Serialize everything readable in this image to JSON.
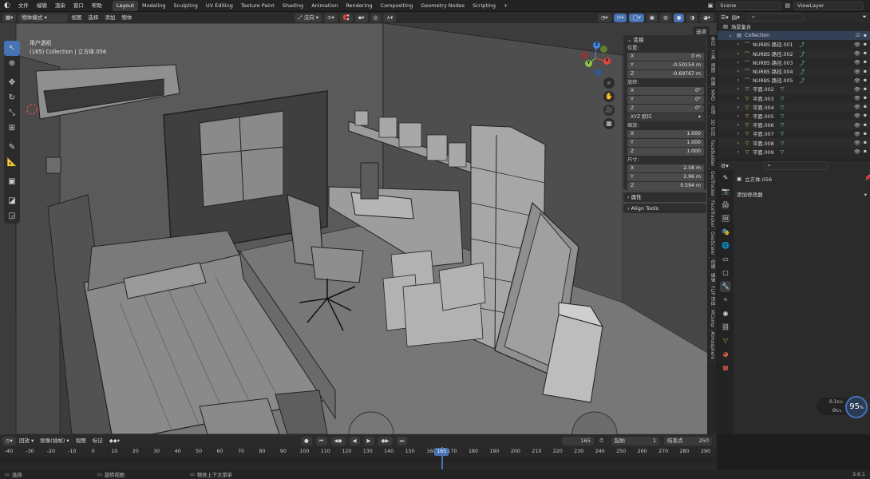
{
  "topbar": {
    "menus": [
      "文件",
      "编辑",
      "渲染",
      "窗口",
      "帮助"
    ],
    "workspaces": [
      "Layout",
      "Modeling",
      "Sculpting",
      "UV Editing",
      "Texture Paint",
      "Shading",
      "Animation",
      "Rendering",
      "Compositing",
      "Geometry Nodes",
      "Scripting"
    ],
    "active_workspace": "Layout",
    "add_tab": "+",
    "scene": "Scene",
    "view_layer": "ViewLayer"
  },
  "viewport_header": {
    "mode": "物体模式",
    "menus": [
      "视图",
      "选择",
      "添加",
      "物体"
    ],
    "orientation": "法向",
    "options": "选项"
  },
  "viewport": {
    "view_name": "用户透视",
    "collection_info": "(165) Collection | 立方体.056"
  },
  "gizmo": {
    "x": "X",
    "y": "Y",
    "z": "Z"
  },
  "npanel": {
    "transform_title": "变换",
    "location_label": "位置:",
    "location": [
      {
        "k": "X",
        "v": "0 m"
      },
      {
        "k": "Y",
        "v": "-0.50154 m"
      },
      {
        "k": "Z",
        "v": "-0.69767 m"
      }
    ],
    "rotation_label": "旋转:",
    "rotation": [
      {
        "k": "X",
        "v": "0°"
      },
      {
        "k": "Y",
        "v": "0°"
      },
      {
        "k": "Z",
        "v": "0°"
      }
    ],
    "rotation_mode": "XYZ 欧拉",
    "scale_label": "缩放:",
    "scale": [
      {
        "k": "X",
        "v": "1.000"
      },
      {
        "k": "Y",
        "v": "1.000"
      },
      {
        "k": "Z",
        "v": "1.000"
      }
    ],
    "dimensions_label": "尺寸:",
    "dimensions": [
      {
        "k": "X",
        "v": "2.58 m"
      },
      {
        "k": "Y",
        "v": "2.96 m"
      },
      {
        "k": "Z",
        "v": "0.594 m"
      }
    ],
    "properties_title": "属性",
    "align_tools_title": "Align Tools"
  },
  "ntabs": [
    "条目",
    "工具",
    "视图",
    "创建",
    "MMD",
    "杂项",
    "3D 打印",
    "FaceBuilder",
    "GeoTracker",
    "FaceTracker",
    "GeoScaler",
    "创建",
    "编辑",
    "FLIP 流体",
    "MComp",
    "Atmosphere"
  ],
  "outliner": {
    "root": "场景集合",
    "collection": "Collection",
    "items": [
      "NURBS 路径.001",
      "NURBS 路径.002",
      "NURBS 路径.003",
      "NURBS 路径.004",
      "NURBS 路径.005",
      "平面.002",
      "平面.003",
      "平面.004",
      "平面.005",
      "平面.006",
      "平面.007",
      "平面.008",
      "平面.009"
    ]
  },
  "properties": {
    "object_name": "立方体.056",
    "add_modifier": "添加修改器"
  },
  "timeline": {
    "menus": [
      "回放",
      "抠像(插帧)",
      "视图",
      "标记"
    ],
    "current_frame": "165",
    "start_label": "起始",
    "start": "1",
    "end_label": "结束点",
    "end": "250",
    "ticks": [
      "-40",
      "-30",
      "-20",
      "-10",
      "0",
      "10",
      "20",
      "30",
      "40",
      "50",
      "60",
      "70",
      "80",
      "90",
      "100",
      "110",
      "120",
      "130",
      "140",
      "150",
      "160",
      "170",
      "180",
      "190",
      "200",
      "210",
      "220",
      "230",
      "240",
      "250",
      "260",
      "270",
      "280",
      "290"
    ]
  },
  "status": {
    "select": "选择",
    "rotate_view": "旋转视图",
    "context_menu": "物体上下文菜单",
    "version": "3.6.1"
  },
  "perf": {
    "up": "0.1",
    "down": "0",
    "unit": "K/s",
    "percent": "95",
    "percent_sign": "%"
  },
  "colors": {
    "accent": "#4772b3",
    "active_frame": "#4772b3",
    "x": "#e2483e",
    "y": "#8bc541",
    "z": "#3d8de3"
  }
}
